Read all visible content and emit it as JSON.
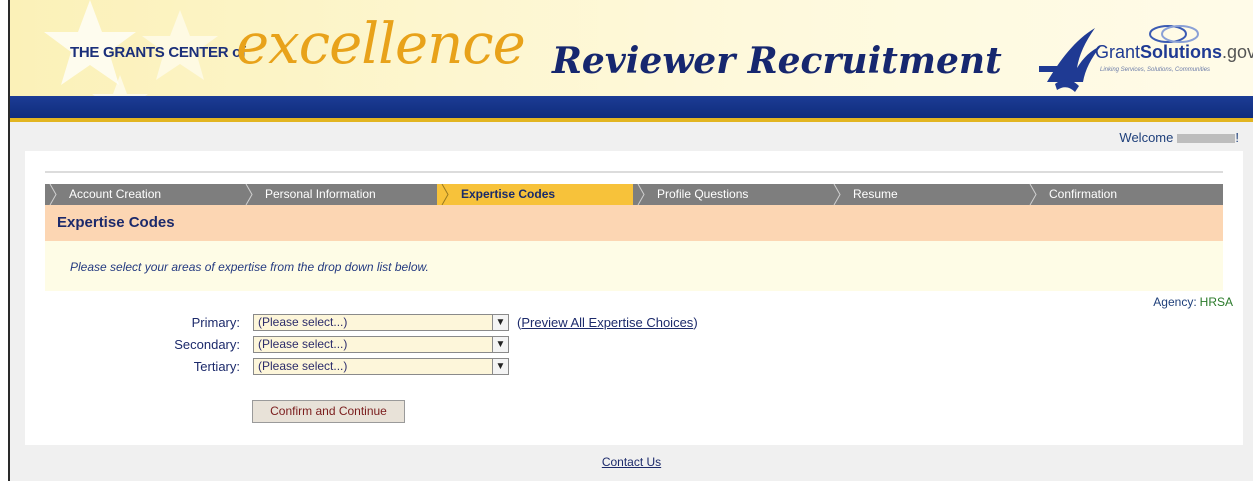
{
  "banner": {
    "brand_small": "THE GRANTS CENTER of",
    "brand_big": "excellence",
    "brand_script": "Reviewer Recruitment",
    "logo_name": "Grant",
    "logo_bold": "Solutions",
    "logo_tld": ".gov",
    "logo_tagline": "Linking Services, Solutions, Communities"
  },
  "welcome": {
    "label": "Welcome",
    "suffix": "!"
  },
  "steps": [
    {
      "label": "Account Creation",
      "active": false
    },
    {
      "label": "Personal Information",
      "active": false
    },
    {
      "label": "Expertise Codes",
      "active": true
    },
    {
      "label": "Profile Questions",
      "active": false
    },
    {
      "label": "Resume",
      "active": false
    },
    {
      "label": "Confirmation",
      "active": false
    }
  ],
  "section": {
    "title": "Expertise Codes",
    "instruction": "Please select your areas of expertise from the drop down list below."
  },
  "agency": {
    "label": "Agency:",
    "value": "HRSA"
  },
  "form": {
    "primary_label": "Primary:",
    "secondary_label": "Secondary:",
    "tertiary_label": "Tertiary:",
    "primary_value": "(Please select...)",
    "secondary_value": "(Please select...)",
    "tertiary_value": "(Please select...)",
    "preview_open": "(",
    "preview_link": "Preview All Expertise Choices",
    "preview_close": ")",
    "confirm_button": "Confirm and Continue"
  },
  "footer": {
    "contact_link": "Contact Us"
  },
  "colors": {
    "banner_blue": "#1c3c95",
    "accent_gold": "#f7c23a",
    "header_peach": "#fcd6b3",
    "text_navy": "#1c2a6b"
  }
}
